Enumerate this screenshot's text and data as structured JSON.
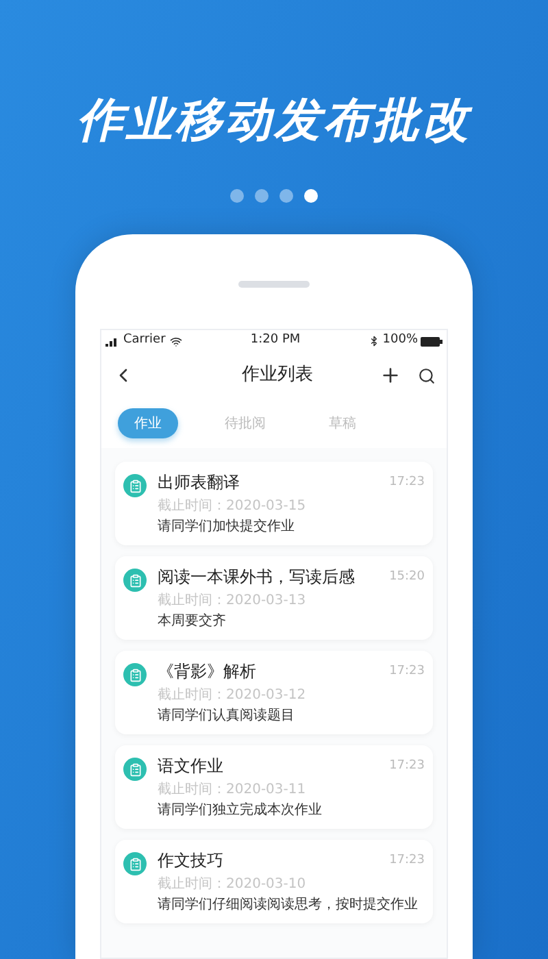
{
  "headline": "作业移动发布批改",
  "pager": [
    {
      "selected": false
    },
    {
      "selected": false
    },
    {
      "selected": false
    },
    {
      "selected": true
    }
  ],
  "status_bar": {
    "carrier": "Carrier",
    "time": "1:20 PM",
    "battery": "100%"
  },
  "nav": {
    "title": "作业列表"
  },
  "tabs": [
    {
      "label": "作业",
      "selected": true
    },
    {
      "label": "待批阅",
      "selected": false
    },
    {
      "label": "草稿",
      "selected": false
    }
  ],
  "assignments": [
    {
      "title": "出师表翻译",
      "time": "17:23",
      "deadline": "截止时间：2020-03-15",
      "note": "请同学们加快提交作业"
    },
    {
      "title": "阅读一本课外书，写读后感",
      "time": "15:20",
      "deadline": "截止时间：2020-03-13",
      "note": "本周要交齐"
    },
    {
      "title": "《背影》解析",
      "time": "17:23",
      "deadline": "截止时间：2020-03-12",
      "note": "请同学们认真阅读题目"
    },
    {
      "title": "语文作业",
      "time": "17:23",
      "deadline": "截止时间：2020-03-11",
      "note": "请同学们独立完成本次作业"
    },
    {
      "title": "作文技巧",
      "time": "17:23",
      "deadline": "截止时间：2020-03-10",
      "note": "请同学们仔细阅读阅读思考，按时提交作业"
    }
  ]
}
